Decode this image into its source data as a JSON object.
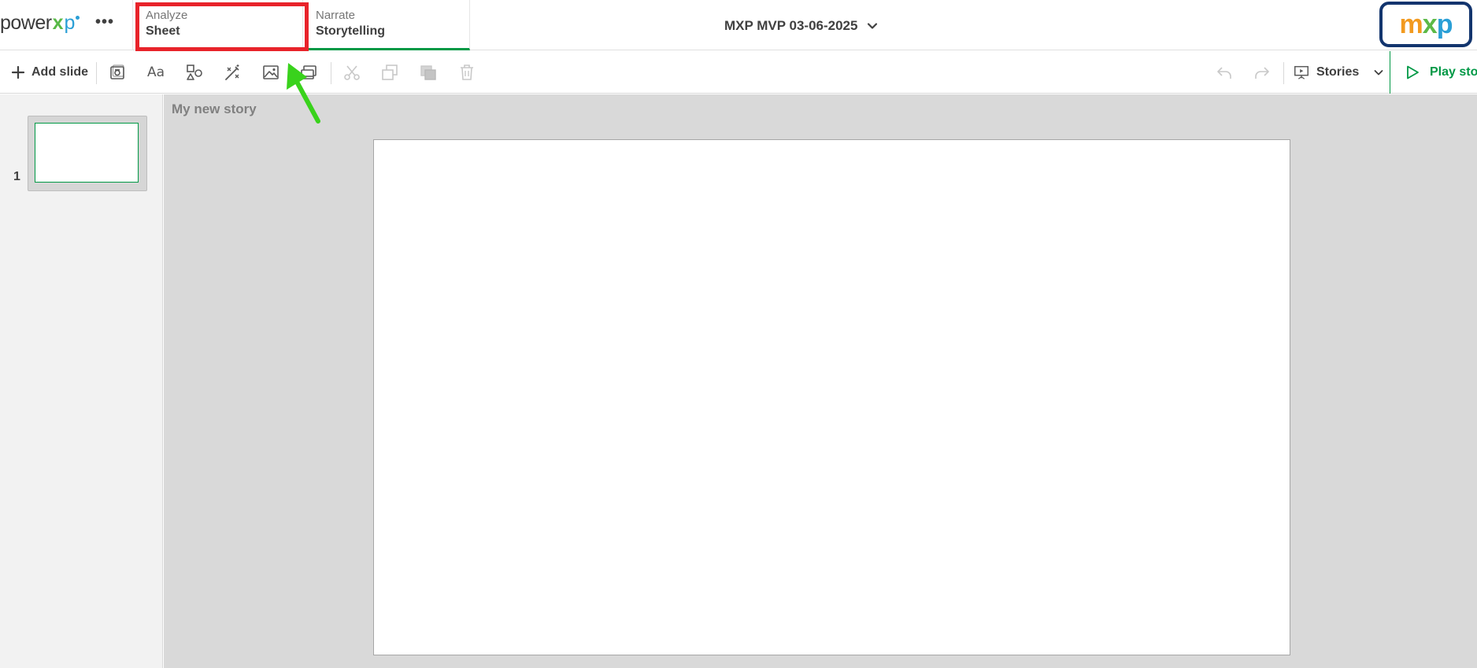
{
  "header": {
    "brand": {
      "word": "power",
      "x": "x",
      "tail": "p"
    },
    "more_label": "•••",
    "tabs": [
      {
        "kicker": "Analyze",
        "title": "Sheet"
      },
      {
        "kicker": "Narrate",
        "title": "Storytelling"
      }
    ],
    "app_title": "MXP MVP 03-06-2025",
    "logo": {
      "m": "m",
      "x": "x",
      "p": "p"
    }
  },
  "toolbar": {
    "add_slide_label": "Add slide",
    "text_tool_label": "Aa",
    "stories_label": "Stories",
    "play_label": "Play story",
    "icons": [
      "plus-icon",
      "snapshot-icon",
      "text-icon",
      "shapes-icon",
      "effects-icon",
      "image-icon",
      "sheet-embed-icon",
      "cut-icon",
      "copy-icon",
      "paste-icon",
      "delete-icon",
      "undo-icon",
      "redo-icon",
      "presentation-icon",
      "chevron-down-icon",
      "play-icon"
    ]
  },
  "slides_panel": {
    "slides": [
      {
        "number": "1"
      }
    ]
  },
  "canvas": {
    "story_name": "My new story"
  },
  "colors": {
    "accent_green": "#009845",
    "highlight_red": "#e8232a",
    "logo_border": "#13356e",
    "arrow_green": "#39d21c"
  }
}
